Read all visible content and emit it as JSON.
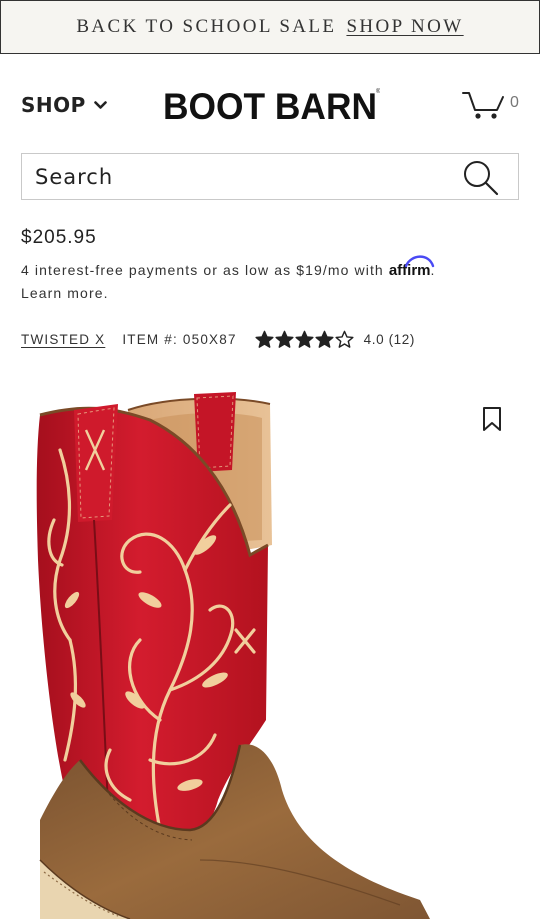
{
  "promo": {
    "text": "BACK TO SCHOOL SALE",
    "link": "SHOP NOW"
  },
  "header": {
    "shop_label": "SHOP",
    "logo_text": "BOOT BARN",
    "cart_count": "0"
  },
  "search": {
    "placeholder": "Search"
  },
  "product": {
    "price": "$205.95",
    "installments_text": "4 interest-free payments or as low as $19/mo with",
    "affirm_label": "affirm",
    "learn_more": "Learn more.",
    "brand": "TWISTED X",
    "item_number": "ITEM #: 050X87",
    "rating": 4.0,
    "rating_text": "4.0 (12)",
    "stars_total": 5
  },
  "colors": {
    "promo_bg": "#f6f5f1",
    "boot_red": "#c8182a",
    "boot_leather": "#8a5e32",
    "embroidery": "#f1cf9d"
  }
}
